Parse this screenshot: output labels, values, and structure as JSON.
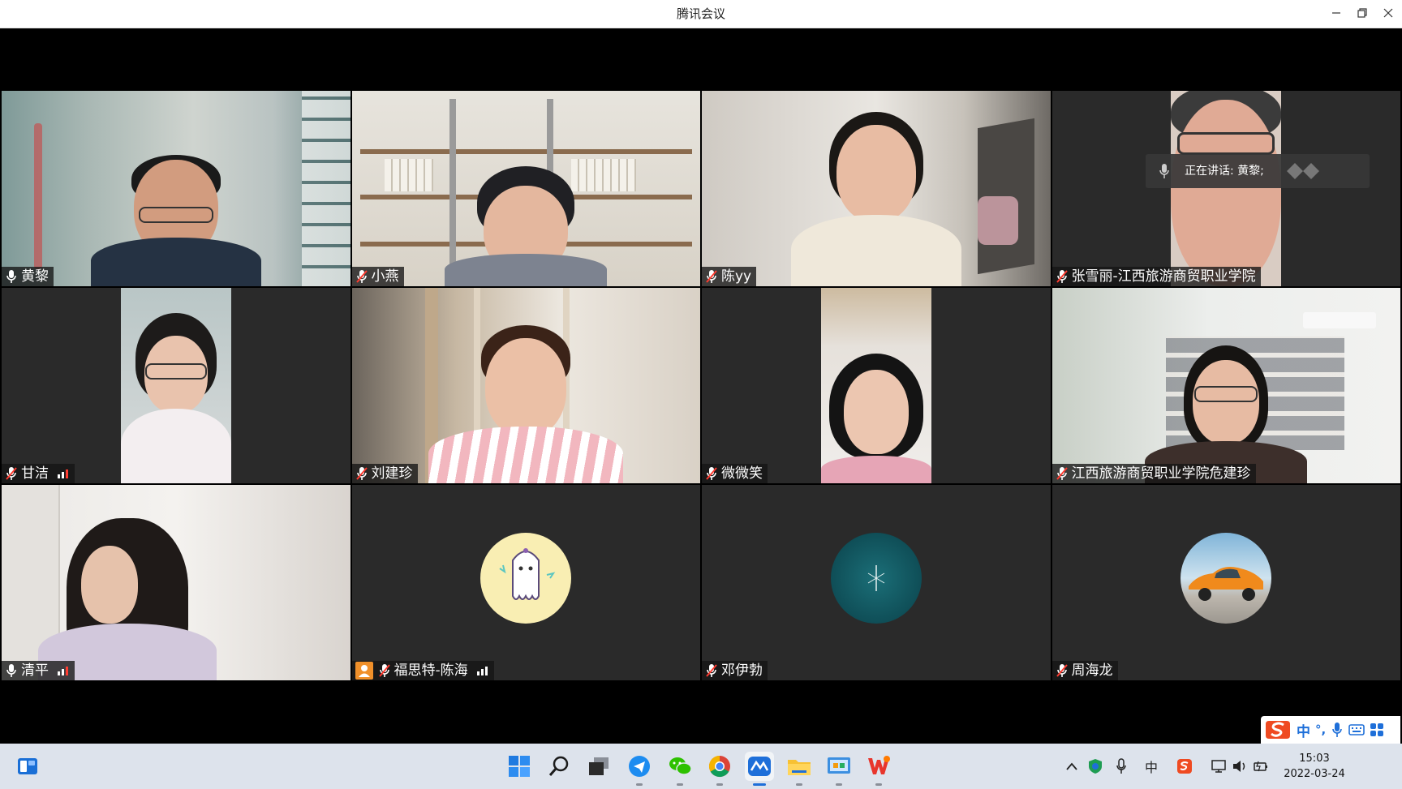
{
  "window": {
    "title": "腾讯会议"
  },
  "speaking": {
    "text": "正在讲话: 黄黎;"
  },
  "participants": [
    {
      "name": "黄黎",
      "mic": "on",
      "active": true
    },
    {
      "name": "小燕",
      "mic": "muted"
    },
    {
      "name": "陈yy",
      "mic": "muted"
    },
    {
      "name": "张雪丽-江西旅游商贸职业学院",
      "mic": "muted"
    },
    {
      "name": "甘洁",
      "mic": "muted",
      "signal": true
    },
    {
      "name": "刘建珍",
      "mic": "muted"
    },
    {
      "name": "微微笑",
      "mic": "muted"
    },
    {
      "name": "江西旅游商贸职业学院危建珍",
      "mic": "muted"
    },
    {
      "name": "清平",
      "mic": "on",
      "signal": true
    },
    {
      "name": "福思特-陈海",
      "mic": "muted",
      "signal": true,
      "host_badge": true
    },
    {
      "name": "邓伊勃",
      "mic": "muted"
    },
    {
      "name": "周海龙",
      "mic": "muted"
    }
  ],
  "ime": {
    "lang": "中",
    "punct": "°,"
  },
  "taskbar": {
    "apps": [
      "widgets-icon",
      "windows-start-icon",
      "search-icon",
      "task-view-icon",
      "feishu-icon",
      "wechat-icon",
      "chrome-icon",
      "tencent-meeting-icon",
      "file-explorer-icon",
      "control-panel-icon",
      "wps-icon"
    ],
    "tray_lang": "中",
    "time": "15:03",
    "date": "2022-03-24"
  },
  "colors": {
    "active_border": "#25b563",
    "tile_bg": "#2a2a2a",
    "taskbar_bg": "#dde3ec"
  }
}
